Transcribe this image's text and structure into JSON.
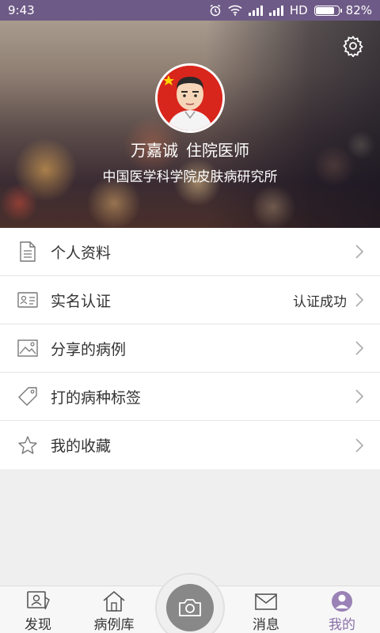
{
  "status_bar": {
    "time": "9:43",
    "network": "HD",
    "battery": "82%",
    "battery_level": 0.82
  },
  "profile": {
    "name": "万嘉诚",
    "title": "住院医师",
    "organization": "中国医学科学院皮肤病研究所"
  },
  "menu": {
    "items": [
      {
        "label": "个人资料",
        "icon": "document-icon",
        "value": ""
      },
      {
        "label": "实名认证",
        "icon": "id-card-icon",
        "value": "认证成功"
      },
      {
        "label": "分享的病例",
        "icon": "image-icon",
        "value": ""
      },
      {
        "label": "打的病种标签",
        "icon": "tag-icon",
        "value": ""
      },
      {
        "label": "我的收藏",
        "icon": "star-icon",
        "value": ""
      }
    ]
  },
  "bottom_nav": {
    "items": [
      {
        "label": "发现",
        "icon": "discover-icon"
      },
      {
        "label": "病例库",
        "icon": "home-icon"
      },
      {
        "label": "消息",
        "icon": "mail-icon"
      },
      {
        "label": "我的",
        "icon": "profile-icon"
      }
    ],
    "active": "我的",
    "camera_icon": "camera-icon"
  },
  "colors": {
    "status_bar": "#6e5a86",
    "accent": "#8a6fa8",
    "background": "#efeff0"
  }
}
